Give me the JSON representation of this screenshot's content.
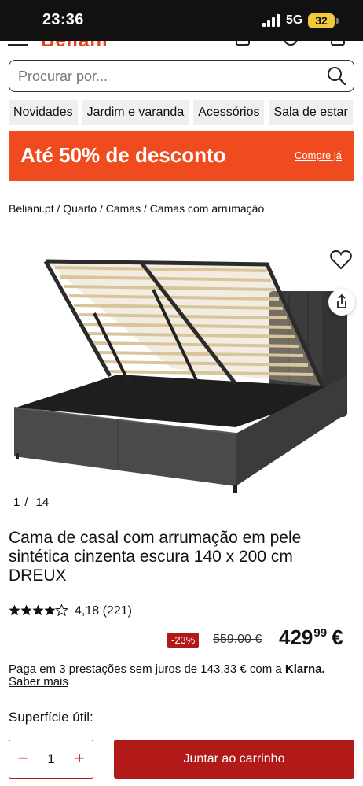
{
  "status_bar": {
    "time": "23:36",
    "network": "5G",
    "battery": "32"
  },
  "header": {
    "logo_text": "Beliani"
  },
  "search": {
    "placeholder": "Procurar por..."
  },
  "categories": [
    "Novidades",
    "Jardim e varanda",
    "Acessórios",
    "Sala de estar"
  ],
  "banner": {
    "text": "Até 50% de desconto",
    "link": "Compre já",
    "color": "#f04b1f"
  },
  "breadcrumb": "Beliani.pt / Quarto / Camas / Camas com arrumação",
  "gallery": {
    "current": "1",
    "separator": "/",
    "total": "14"
  },
  "product": {
    "title": "Cama de casal com arrumação em pele sintética cinzenta escura 140 x 200 cm DREUX",
    "rating_stars": 4.18,
    "rating_text": "4,18 (221)",
    "discount": "-23%",
    "old_price": "559,00 €",
    "price_int": "429",
    "price_dec": "99",
    "currency": "€",
    "installments_text": "Paga em 3 prestações sem juros de 143,33 € com a",
    "installments_brand": "Klarna.",
    "more_link": "Saber mais",
    "surface_label": "Superfície útil:"
  },
  "actions": {
    "quantity": "1",
    "add_to_cart": "Juntar ao carrinho",
    "accent": "#b21a1a"
  },
  "icons": [
    "menu-icon",
    "search-icon",
    "heart-icon",
    "share-icon",
    "star-icon",
    "minus-icon",
    "plus-icon"
  ]
}
